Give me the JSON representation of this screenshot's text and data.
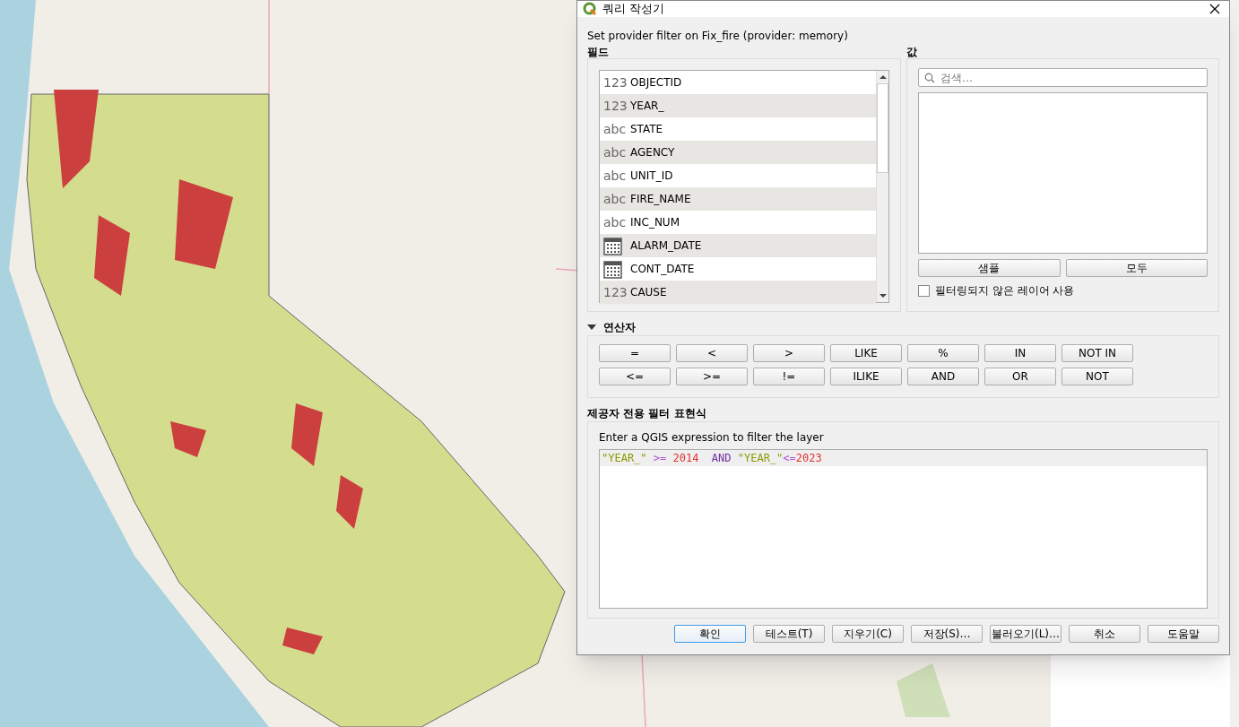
{
  "dialog": {
    "title": "쿼리 작성기",
    "subtitle": "Set provider filter on Fix_fire (provider: memory)"
  },
  "fields": {
    "title": "필드",
    "items": [
      {
        "kind": "number",
        "type_label": "123",
        "name": "OBJECTID"
      },
      {
        "kind": "number",
        "type_label": "123",
        "name": "YEAR_"
      },
      {
        "kind": "text",
        "type_label": "abc",
        "name": "STATE"
      },
      {
        "kind": "text",
        "type_label": "abc",
        "name": "AGENCY"
      },
      {
        "kind": "text",
        "type_label": "abc",
        "name": "UNIT_ID"
      },
      {
        "kind": "text",
        "type_label": "abc",
        "name": "FIRE_NAME"
      },
      {
        "kind": "text",
        "type_label": "abc",
        "name": "INC_NUM"
      },
      {
        "kind": "date",
        "name": "ALARM_DATE"
      },
      {
        "kind": "date",
        "name": "CONT_DATE"
      },
      {
        "kind": "number",
        "type_label": "123",
        "name": "CAUSE"
      }
    ]
  },
  "values": {
    "title": "값",
    "search": {
      "placeholder": "검색…"
    },
    "buttons": [
      "샘플",
      "모두"
    ],
    "checkbox": {
      "label": "필터링되지 않은 레이어 사용",
      "checked": false
    }
  },
  "operators": {
    "title": "연산자",
    "expanded": true,
    "rows": [
      [
        "=",
        "<",
        ">",
        "LIKE",
        "%",
        "IN",
        "NOT IN"
      ],
      [
        "<=",
        ">=",
        "!=",
        "ILIKE",
        "AND",
        "OR",
        "NOT"
      ]
    ]
  },
  "expression": {
    "title": "제공자 전용 필터 표현식",
    "hint": "Enter a QGIS expression to filter the layer",
    "tokens": [
      {
        "kind": "field",
        "text": "\"YEAR_\""
      },
      {
        "kind": "operator",
        "text": " >="
      },
      {
        "kind": "number",
        "text": " 2014"
      },
      {
        "kind": "keyword",
        "text": "  AND"
      },
      {
        "kind": "field",
        "text": " \"YEAR_\""
      },
      {
        "kind": "operator",
        "text": "<="
      },
      {
        "kind": "number",
        "text": "2023"
      }
    ]
  },
  "buttons": [
    {
      "label": "확인",
      "focused": true
    },
    {
      "label": "테스트(T)",
      "focused": false
    },
    {
      "label": "지우기(C)",
      "focused": false
    },
    {
      "label": "저장(S)…",
      "focused": false
    },
    {
      "label": "불러오기(L)…",
      "focused": false
    },
    {
      "label": "취소",
      "focused": false
    },
    {
      "label": "도움말",
      "focused": false
    }
  ]
}
